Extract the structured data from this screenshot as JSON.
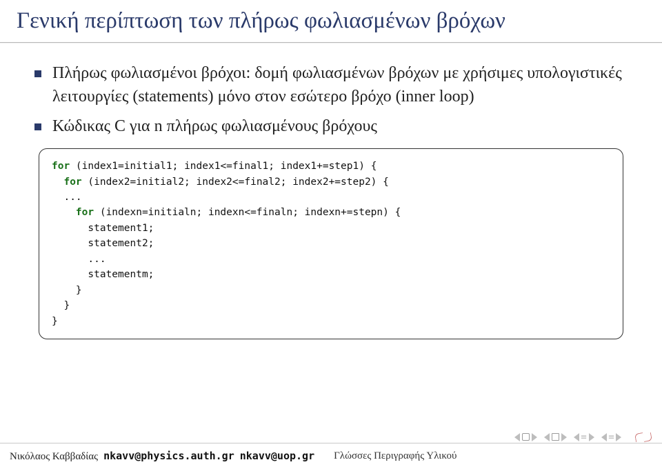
{
  "title": "Γενική περίπτωση των πλήρως φωλιασμένων βρόχων",
  "bullets": [
    "Πλήρως φωλιασμένοι βρόχοι: δομή φωλιασμένων βρόχων με χρήσιμες υπολογιστικές λειτουργίες (statements) μόνο στον εσώτερο βρόχο (inner loop)",
    "Κώδικας C για n πλήρως φωλιασμένους βρόχους"
  ],
  "code": {
    "l1a": "for",
    "l1b": " (index1=initial1; index1<=final1; index1+=step1) {",
    "l2a": "  for",
    "l2b": " (index2=initial2; index2<=final2; index2+=step2) {",
    "l3": "  ...",
    "l4a": "    for",
    "l4b": " (indexn=initialn; indexn<=finaln; indexn+=stepn) {",
    "l5": "      statement1;",
    "l6": "      statement2;",
    "l7": "      ...",
    "l8": "      statementm;",
    "l9": "    }",
    "l10": "  }",
    "l11": "}"
  },
  "footer": {
    "author": "Νικόλαος Καββαδίας",
    "email1": "nkavv@physics.auth.gr",
    "email2": "nkavv@uop.gr",
    "mid": "Γλώσσες Περιγραφής Υλικού"
  }
}
